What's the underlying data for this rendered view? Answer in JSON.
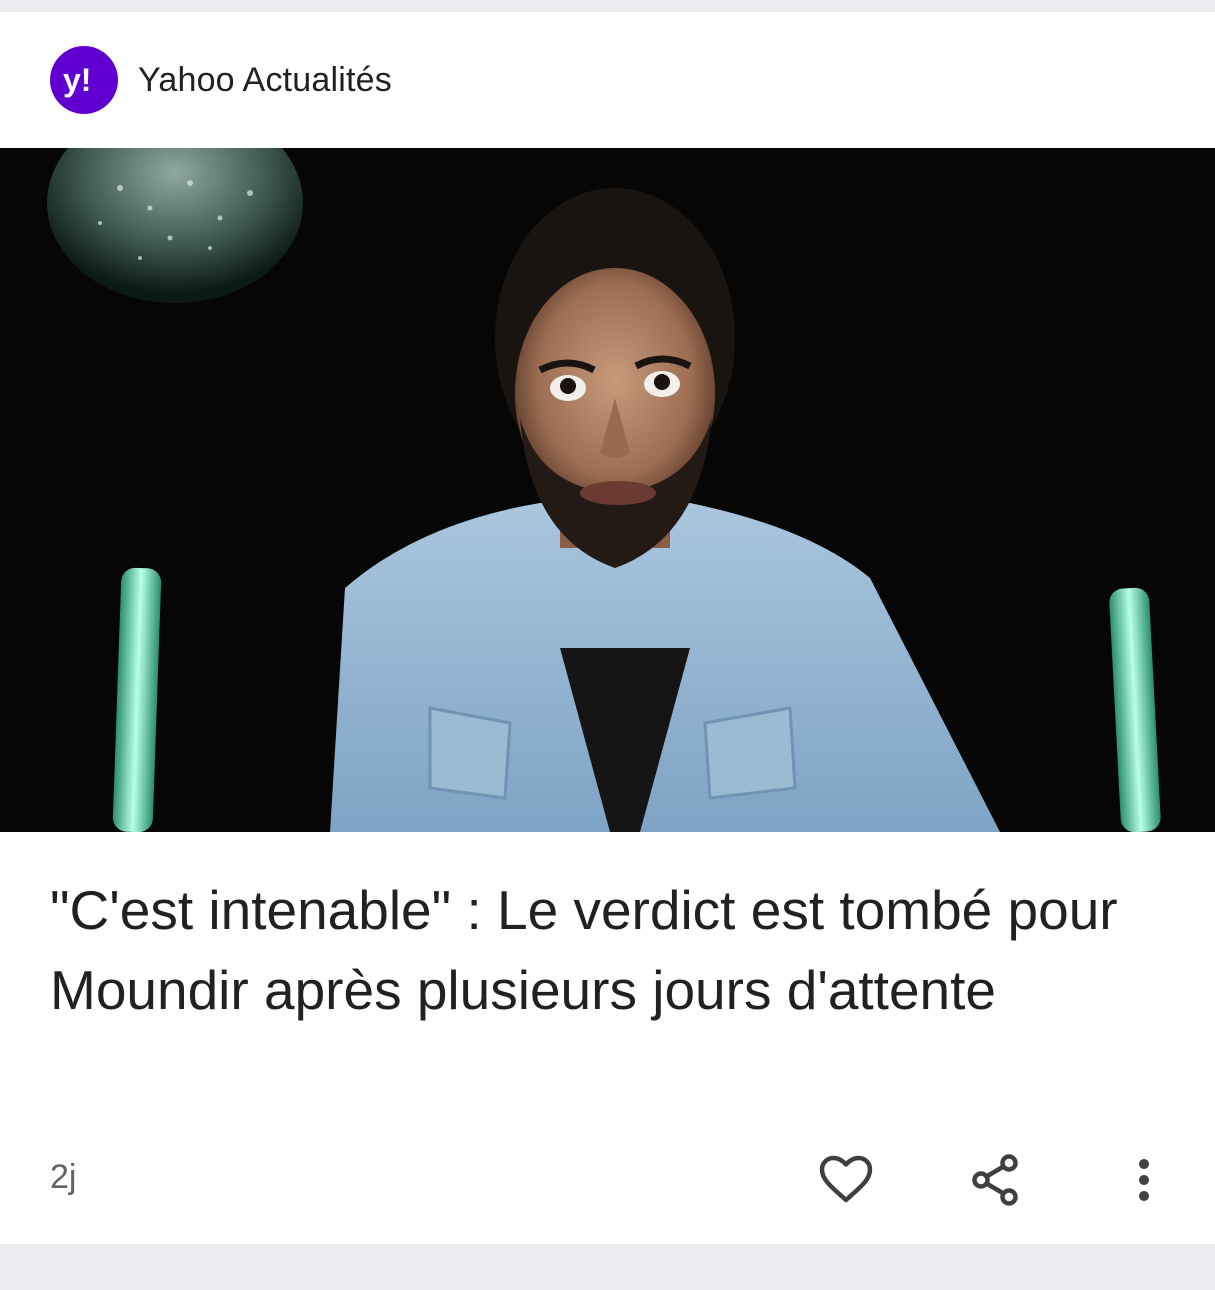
{
  "source": {
    "logo_text": "y!",
    "name": "Yahoo Actualités",
    "brand_color": "#6001d2"
  },
  "article": {
    "headline": "\"C'est intenable\" : Le verdict est tombé pour Moundir après plusieurs jours d'attente",
    "age": "2j",
    "image_icon": "photo-of-man-in-denim-jacket"
  },
  "actions": [
    {
      "name": "like",
      "icon": "heart-icon"
    },
    {
      "name": "share",
      "icon": "share-icon"
    },
    {
      "name": "more",
      "icon": "more-vert-icon"
    }
  ]
}
